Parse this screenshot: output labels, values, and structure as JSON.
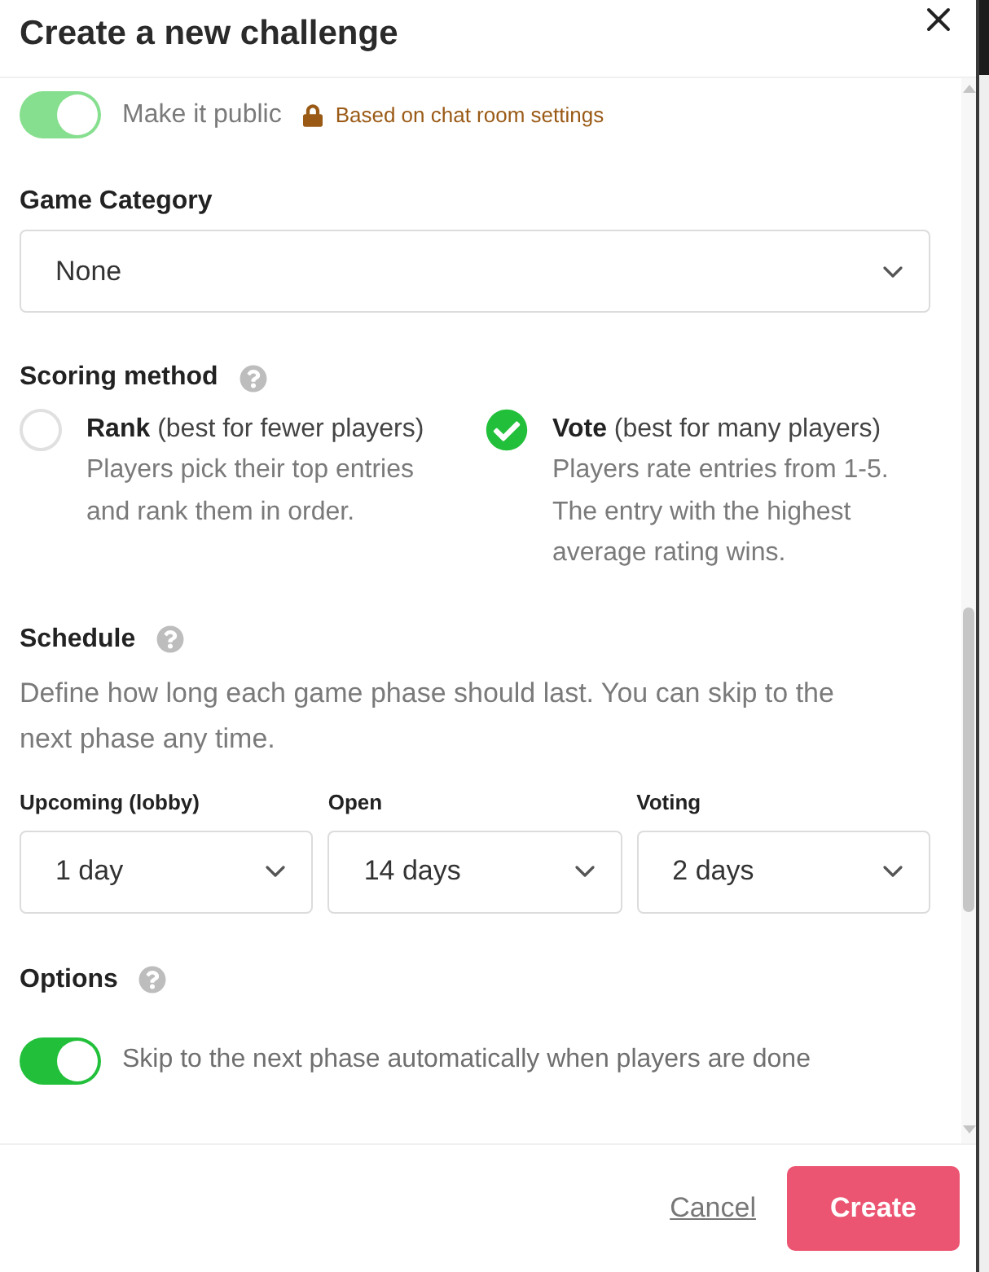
{
  "dialog": {
    "title": "Create a new challenge"
  },
  "visibility": {
    "toggle": {
      "label": "Make it public",
      "on": true,
      "disabled": true
    },
    "note": "Based on chat room settings"
  },
  "game_category": {
    "label": "Game Category",
    "value": "None"
  },
  "scoring_method": {
    "label": "Scoring method",
    "options": [
      {
        "title": "**Rank** (best for fewer players)",
        "description": "Players pick their top entries and rank them in order.",
        "selected": false
      },
      {
        "title": "**Vote** (best for many players)",
        "description": "Players rate entries from 1-5. The entry with the highest average rating wins.",
        "selected": true
      }
    ]
  },
  "schedule": {
    "label": "Schedule",
    "description": "Define how long each game phase should last. You can skip to the next phase any time.",
    "phases": [
      {
        "label": "Upcoming (lobby)",
        "value": "1 day"
      },
      {
        "label": "Open",
        "value": "14 days"
      },
      {
        "label": "Voting",
        "value": "2 days"
      }
    ]
  },
  "options": {
    "label": "Options",
    "toggles": [
      {
        "label": "Skip to the next phase automatically when players are done",
        "on": true,
        "disabled": false
      }
    ]
  },
  "footer": {
    "buttons": [
      {
        "label": "Cancel",
        "kind": "link"
      },
      {
        "label": "Create",
        "kind": "primary"
      }
    ]
  }
}
